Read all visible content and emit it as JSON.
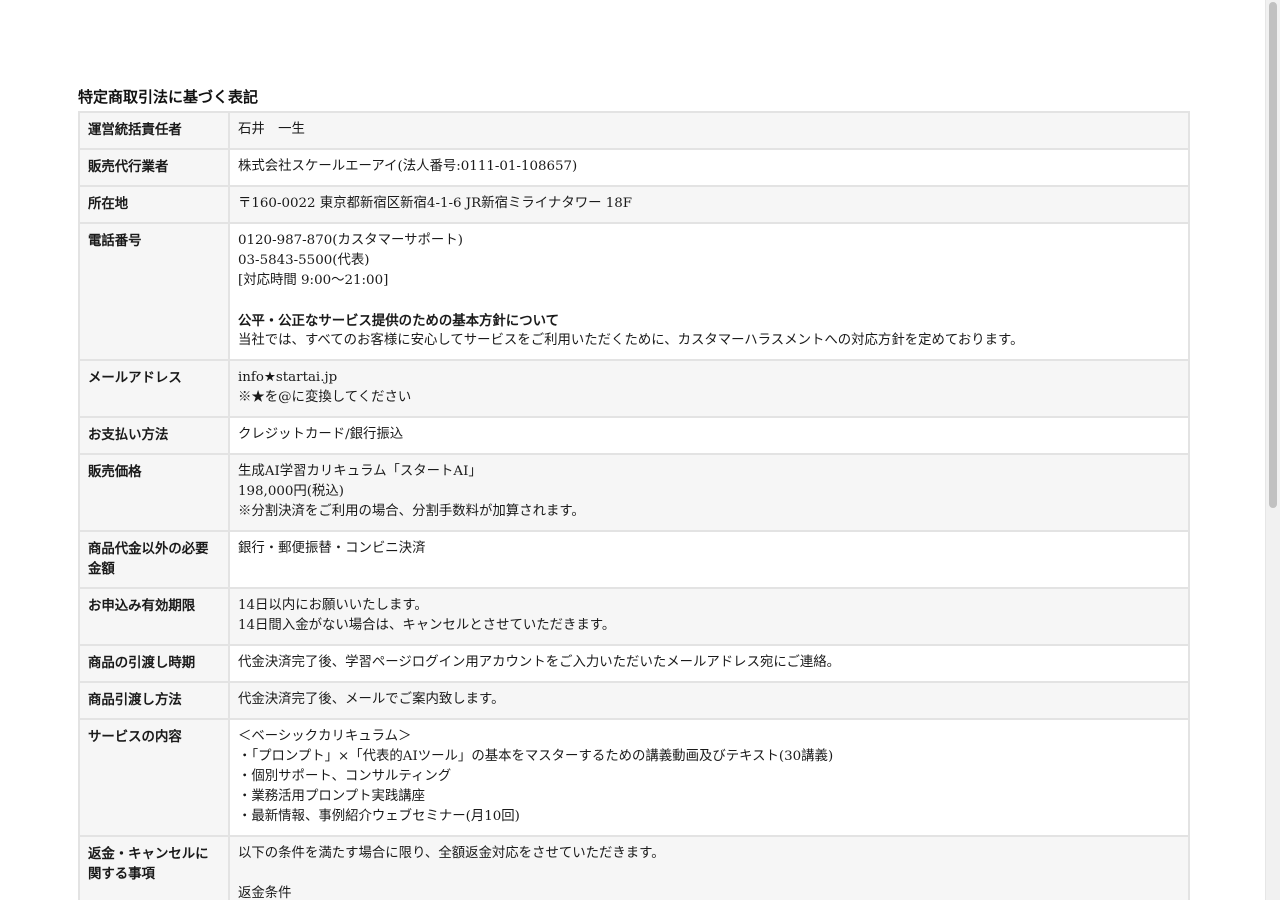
{
  "title": "特定商取引法に基づく表記",
  "rows": [
    {
      "label": "運営統括責任者",
      "lines": [
        {
          "text": "石井　一生"
        }
      ]
    },
    {
      "label": "販売代行業者",
      "lines": [
        {
          "text": "株式会社スケールエーアイ(法人番号:0111-01-108657)"
        }
      ]
    },
    {
      "label": "所在地",
      "lines": [
        {
          "text": "〒160-0022 東京都新宿区新宿4-1-6 JR新宿ミライナタワー 18F"
        }
      ]
    },
    {
      "label": "電話番号",
      "lines": [
        {
          "text": "0120-987-870(カスタマーサポート)"
        },
        {
          "text": "03-5843-5500(代表)"
        },
        {
          "text": "[対応時間 9:00〜21:00]"
        },
        {
          "text": ""
        },
        {
          "text": "公平・公正なサービス提供のための基本方針について",
          "bold": true
        },
        {
          "text": "当社では、すべてのお客様に安心してサービスをご利用いただくために、カスタマーハラスメントへの対応方針を定めております。"
        }
      ]
    },
    {
      "label": "メールアドレス",
      "lines": [
        {
          "text": "info★startai.jp"
        },
        {
          "text": "※★を@に変換してください"
        }
      ]
    },
    {
      "label": "お支払い方法",
      "lines": [
        {
          "text": "クレジットカード/銀行振込"
        }
      ]
    },
    {
      "label": "販売価格",
      "lines": [
        {
          "text": "生成AI学習カリキュラム「スタートAI」"
        },
        {
          "text": "198,000円(税込)"
        },
        {
          "text": "※分割決済をご利用の場合、分割手数料が加算されます。"
        }
      ]
    },
    {
      "label": "商品代金以外の必要金額",
      "lines": [
        {
          "text": "銀行・郵便振替・コンビニ決済"
        }
      ]
    },
    {
      "label": "お申込み有効期限",
      "lines": [
        {
          "text": "14日以内にお願いいたします。"
        },
        {
          "text": "14日間入金がない場合は、キャンセルとさせていただきます。"
        }
      ]
    },
    {
      "label": "商品の引渡し時期",
      "lines": [
        {
          "text": "代金決済完了後、学習ページログイン用アカウントをご入力いただいたメールアドレス宛にご連絡。"
        }
      ]
    },
    {
      "label": "商品引渡し方法",
      "lines": [
        {
          "text": "代金決済完了後、メールでご案内致します。"
        }
      ]
    },
    {
      "label": "サービスの内容",
      "lines": [
        {
          "text": "＜ベーシックカリキュラム＞"
        },
        {
          "text": "・「プロンプト」×「代表的AIツール」の基本をマスターするための講義動画及びテキスト(30講義)"
        },
        {
          "text": "・個別サポート、コンサルティング"
        },
        {
          "text": "・業務活用プロンプト実践講座"
        },
        {
          "text": "・最新情報、事例紹介ウェブセミナー(月10回)"
        }
      ]
    },
    {
      "label": "返金・キャンセルに関する事項",
      "lines": [
        {
          "text": "以下の条件を満たす場合に限り、全額返金対応をさせていただきます。"
        },
        {
          "text": ""
        },
        {
          "text": "返金条件"
        }
      ]
    }
  ]
}
